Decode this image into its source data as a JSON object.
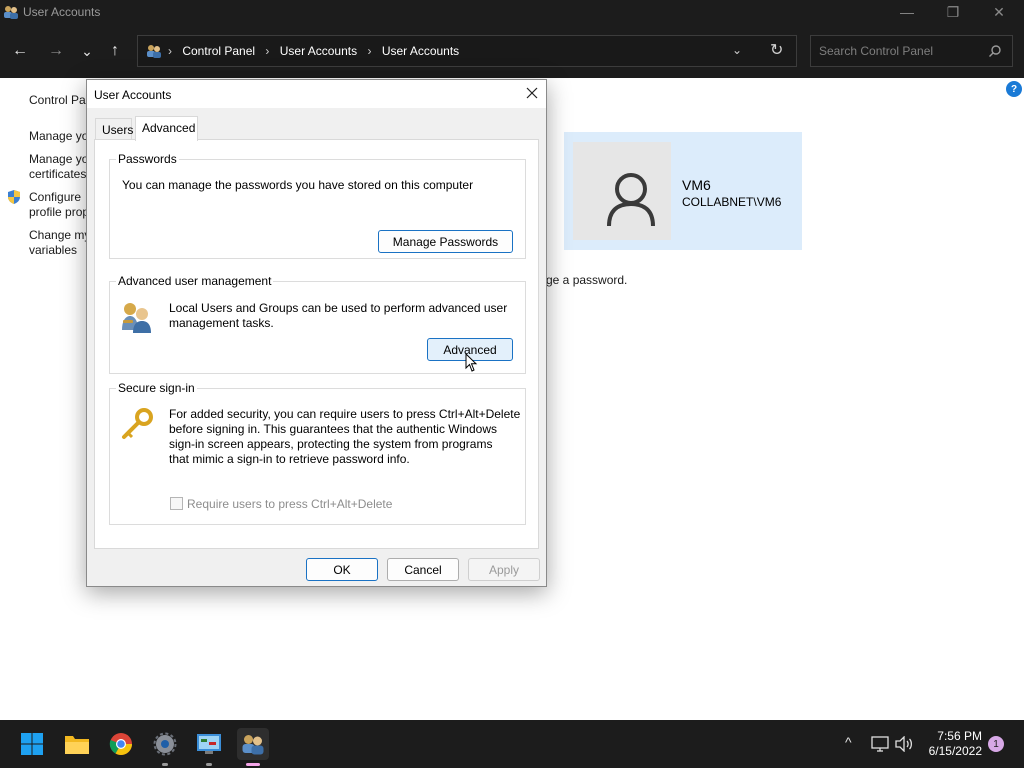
{
  "window": {
    "title": "User Accounts",
    "min_icon": "—",
    "max_icon": "❐",
    "close_icon": "✕"
  },
  "nav": {
    "back": "←",
    "forward": "→",
    "recent": "⌄",
    "up": "↑",
    "breadcrumb": [
      "Control Panel",
      "User Accounts",
      "User Accounts"
    ],
    "separator": "›",
    "dropdown": "⌄",
    "refresh": "↻",
    "search_placeholder": "Search Control Panel"
  },
  "background": {
    "side_links": [
      "Control Pa",
      "Manage yo",
      "Manage yo",
      "certificates",
      "Configure",
      "profile prop",
      "Change my",
      "variables"
    ],
    "user_name": "VM6",
    "user_domain": "COLLABNET\\VM6",
    "password_text": "ge a password.",
    "help_label": "?"
  },
  "dialog": {
    "title": "User Accounts",
    "tabs": [
      {
        "label": "Users",
        "active": false
      },
      {
        "label": "Advanced",
        "active": true
      }
    ],
    "passwords": {
      "legend": "Passwords",
      "text": "You can manage the passwords you have stored on this computer",
      "button": "Manage Passwords"
    },
    "advanced_mgmt": {
      "legend": "Advanced user management",
      "text_line1": "Local Users and Groups can be used to perform advanced user",
      "text_line2": "management tasks.",
      "button": "Advanced"
    },
    "secure_signin": {
      "legend": "Secure sign-in",
      "lines": [
        "For added security, you can require users to press Ctrl+Alt+Delete",
        "before signing in. This guarantees that the authentic Windows",
        "sign-in screen appears, protecting the system from programs",
        "that mimic a sign-in to retrieve password info."
      ],
      "checkbox_label": "Require users to press Ctrl+Alt+Delete",
      "checkbox_checked": false
    },
    "buttons": {
      "ok": "OK",
      "cancel": "Cancel",
      "apply": "Apply"
    }
  },
  "taskbar": {
    "items": [
      "start-icon",
      "file-explorer-icon",
      "chrome-icon",
      "settings-icon",
      "control-panel-icon",
      "user-accounts-icon"
    ],
    "tray_chevron": "^",
    "time": "7:56 PM",
    "date": "6/15/2022",
    "notification_count": "1"
  },
  "colors": {
    "accent": "#1a72c4",
    "selection": "#dcecfb",
    "dark_chrome": "#1c1c1c"
  }
}
